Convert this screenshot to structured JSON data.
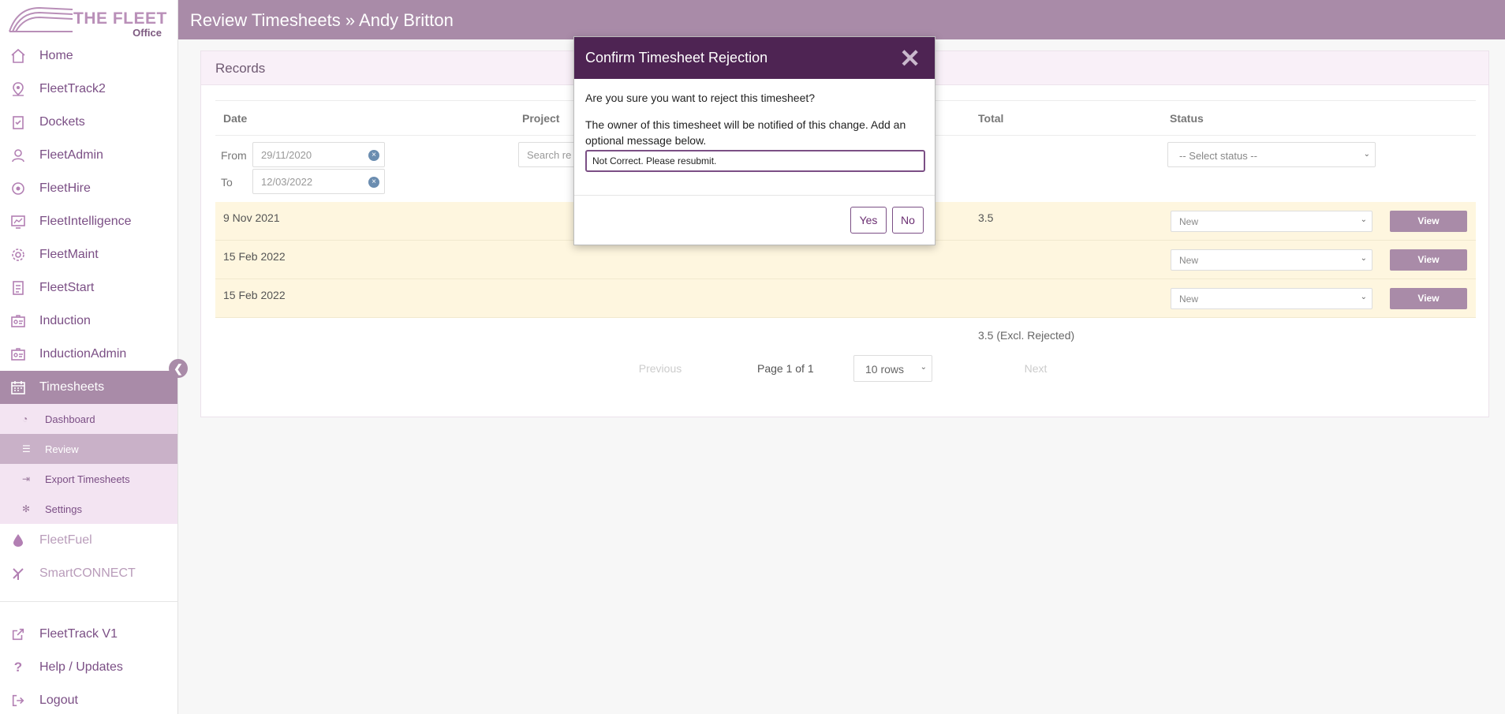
{
  "logo": {
    "line1": "THE FLEET",
    "line2": "Office"
  },
  "header": {
    "title": "Review Timesheets",
    "sep": "»",
    "name": "Andy Britton"
  },
  "sidebar": {
    "items": [
      {
        "label": "Home",
        "icon": "home-icon"
      },
      {
        "label": "FleetTrack2",
        "icon": "map-pin-icon"
      },
      {
        "label": "Dockets",
        "icon": "clipboard-icon"
      },
      {
        "label": "FleetAdmin",
        "icon": "user-icon"
      },
      {
        "label": "FleetHire",
        "icon": "hire-icon"
      },
      {
        "label": "FleetIntelligence",
        "icon": "dashboard-icon"
      },
      {
        "label": "FleetMaint",
        "icon": "gear-icon"
      },
      {
        "label": "FleetStart",
        "icon": "checklist-icon"
      },
      {
        "label": "Induction",
        "icon": "id-card-icon"
      },
      {
        "label": "InductionAdmin",
        "icon": "id-card-admin-icon"
      },
      {
        "label": "Timesheets",
        "icon": "calendar-icon"
      }
    ],
    "sub_items": [
      {
        "label": "Dashboard",
        "icon": "tachometer-icon"
      },
      {
        "label": "Review",
        "icon": "list-icon"
      },
      {
        "label": "Export Timesheets",
        "icon": "export-icon"
      },
      {
        "label": "Settings",
        "icon": "cog-icon"
      }
    ],
    "dim_items": [
      {
        "label": "FleetFuel",
        "icon": "drop-icon"
      },
      {
        "label": "SmartCONNECT",
        "icon": "connect-icon"
      }
    ],
    "bottom_items": [
      {
        "label": "FleetTrack V1",
        "icon": "external-link-icon"
      },
      {
        "label": "Help / Updates",
        "icon": "question-icon"
      },
      {
        "label": "Logout",
        "icon": "logout-icon"
      }
    ]
  },
  "records": {
    "title": "Records",
    "columns": {
      "date": "Date",
      "project": "Project",
      "total": "Total",
      "status": "Status"
    },
    "filters": {
      "from_label": "From",
      "from_value": "29/11/2020",
      "to_label": "To",
      "to_value": "12/03/2022",
      "search_placeholder": "Search re",
      "status_placeholder": "-- Select status --"
    },
    "rows": [
      {
        "date": "9 Nov 2021",
        "total": "3.5",
        "status": "New",
        "action": "View"
      },
      {
        "date": "15 Feb 2022",
        "total": "",
        "status": "New",
        "action": "View"
      },
      {
        "date": "15 Feb 2022",
        "total": "",
        "status": "New",
        "action": "View"
      }
    ],
    "summary_total": "3.5 (Excl. Rejected)",
    "pager": {
      "previous": "Previous",
      "page_info": "Page 1 of 1",
      "rows_option": "10 rows",
      "next": "Next"
    }
  },
  "modal": {
    "title": "Confirm Timesheet Rejection",
    "question": "Are you sure you want to reject this timesheet?",
    "info": "The owner of this timesheet will be notified of this change. Add an optional message below.",
    "message_value": "Not Correct. Please resubmit.",
    "yes": "Yes",
    "no": "No"
  },
  "colors": {
    "brand": "#a98ba8",
    "modal_header": "#4e2453",
    "row_highlight": "#fef6df"
  }
}
